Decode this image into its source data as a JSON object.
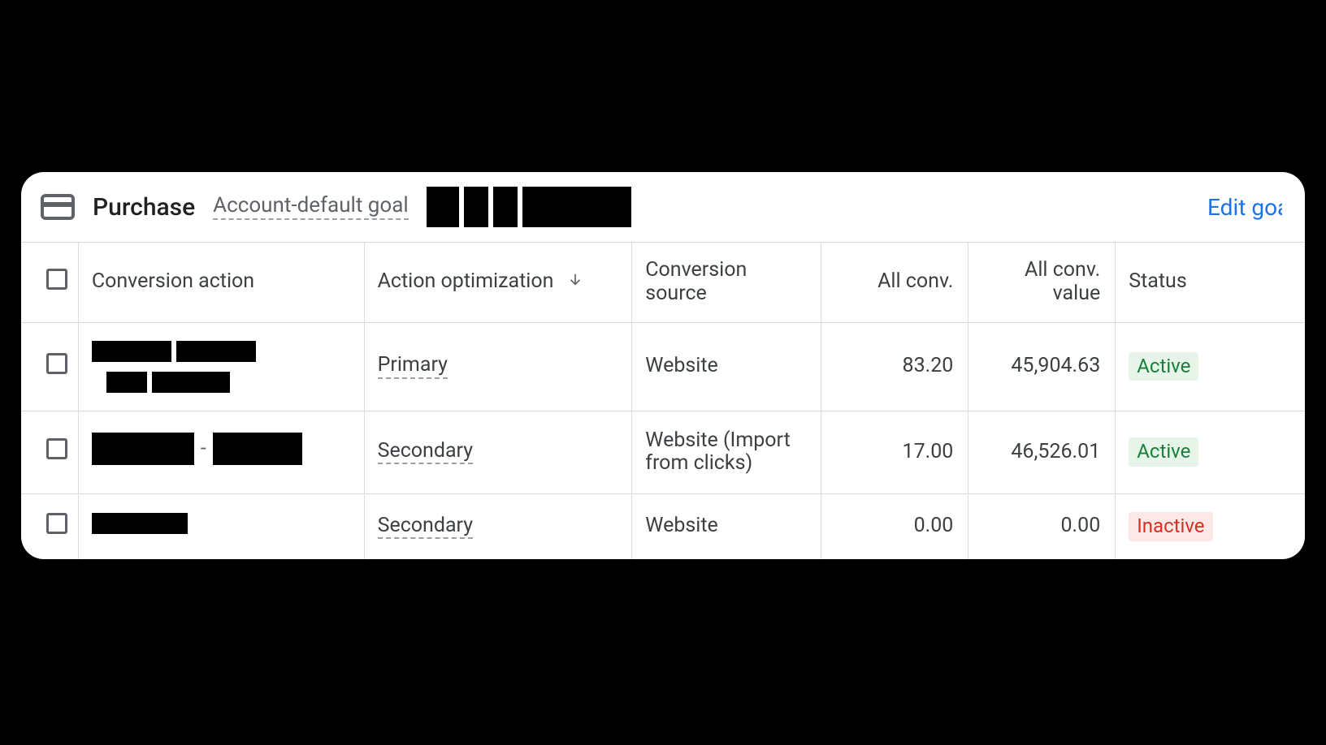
{
  "header": {
    "title": "Purchase",
    "subtitle": "Account-default goal",
    "edit_link": "Edit goal"
  },
  "table": {
    "columns": {
      "action": "Conversion action",
      "optimization": "Action optimization",
      "source": "Conversion source",
      "all_conv": "All conv.",
      "all_conv_value": "All conv. value",
      "status": "Status"
    },
    "rows": [
      {
        "optimization": "Primary",
        "source": "Website",
        "all_conv": "83.20",
        "all_conv_value": "45,904.63",
        "status": "Active",
        "status_class": "active"
      },
      {
        "optimization": "Secondary",
        "source": "Website (Import from clicks)",
        "all_conv": "17.00",
        "all_conv_value": "46,526.01",
        "status": "Active",
        "status_class": "active"
      },
      {
        "optimization": "Secondary",
        "source": "Website",
        "all_conv": "0.00",
        "all_conv_value": "0.00",
        "status": "Inactive",
        "status_class": "inactive"
      }
    ]
  }
}
